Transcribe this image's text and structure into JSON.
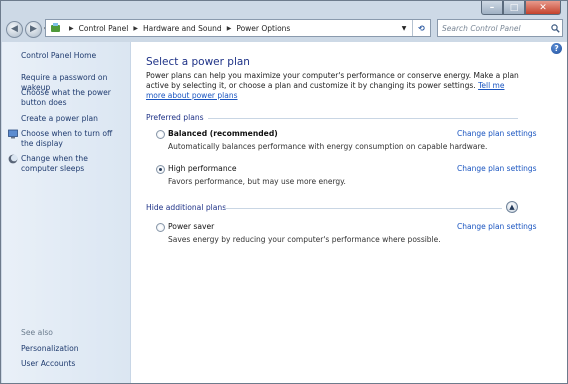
{
  "address": {
    "crumbs": [
      "Control Panel",
      "Hardware and Sound",
      "Power Options"
    ]
  },
  "search": {
    "placeholder": "Search Control Panel"
  },
  "sidebar": {
    "home": "Control Panel Home",
    "links": [
      "Require a password on wakeup",
      "Choose what the power button does",
      "Create a power plan",
      "Choose when to turn off the display",
      "Change when the computer sleeps"
    ],
    "see_also_label": "See also",
    "see_also": [
      "Personalization",
      "User Accounts"
    ]
  },
  "main": {
    "title": "Select a power plan",
    "intro": "Power plans can help you maximize your computer's performance or conserve energy. Make a plan active by selecting it, or choose a plan and customize it by changing its power settings.",
    "intro_link": "Tell me more about power plans",
    "preferred_label": "Preferred plans",
    "hide_label": "Hide additional plans",
    "change_label": "Change plan settings",
    "plans": [
      {
        "name": "Balanced (recommended)",
        "desc": "Automatically balances performance with energy consumption on capable hardware.",
        "selected": false
      },
      {
        "name": "High performance",
        "desc": "Favors performance, but may use more energy.",
        "selected": true
      },
      {
        "name": "Power saver",
        "desc": "Saves energy by reducing your computer's performance where possible.",
        "selected": false
      }
    ]
  }
}
